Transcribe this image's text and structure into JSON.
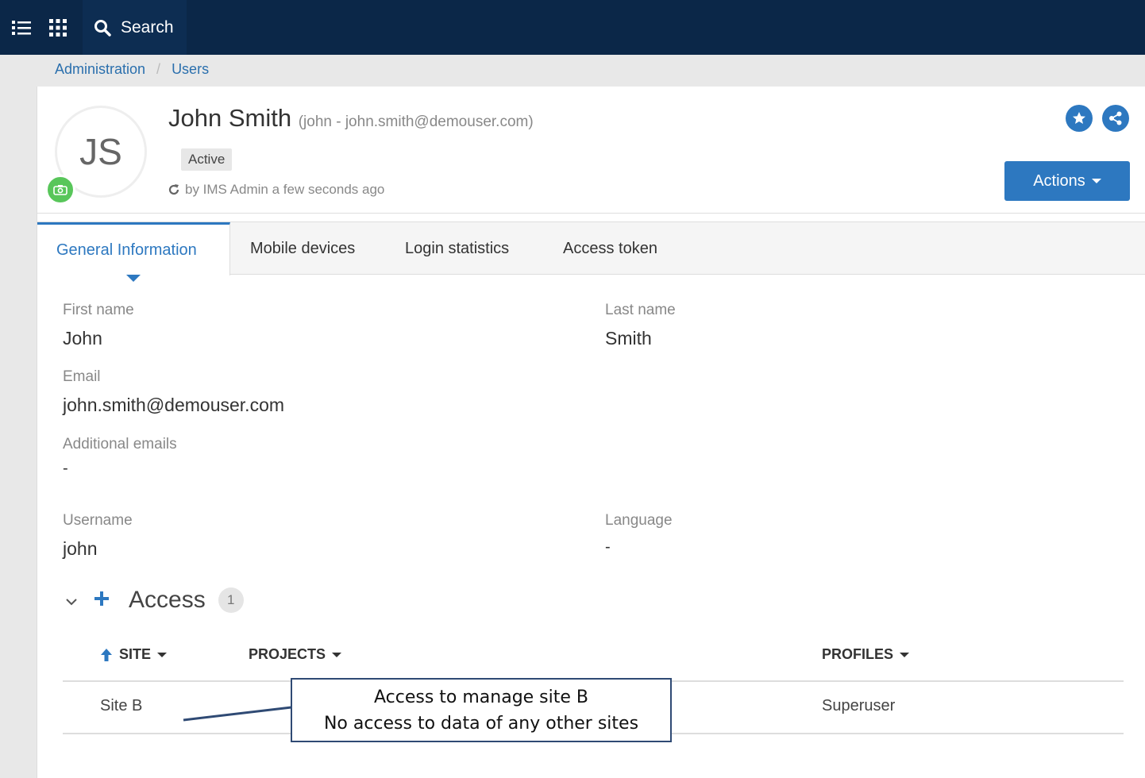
{
  "topbar": {
    "search_label": "Search"
  },
  "breadcrumb": {
    "items": [
      "Administration",
      "Users"
    ],
    "separator": "/"
  },
  "user": {
    "initials": "JS",
    "name": "John Smith",
    "subtitle": "(john - john.smith@demouser.com)",
    "status": "Active",
    "updated": "by IMS Admin a few seconds ago"
  },
  "header": {
    "actions_label": "Actions"
  },
  "tabs": [
    {
      "label": "General Information",
      "active": true
    },
    {
      "label": "Mobile devices"
    },
    {
      "label": "Login statistics"
    },
    {
      "label": "Access token"
    }
  ],
  "fields": {
    "first_name": {
      "label": "First name",
      "value": "John"
    },
    "last_name": {
      "label": "Last name",
      "value": "Smith"
    },
    "email": {
      "label": "Email",
      "value": "john.smith@demouser.com"
    },
    "additional_emails": {
      "label": "Additional emails",
      "value": "-"
    },
    "username": {
      "label": "Username",
      "value": "john"
    },
    "language": {
      "label": "Language",
      "value": "-"
    }
  },
  "access": {
    "title": "Access",
    "count": "1",
    "columns": {
      "site": "SITE",
      "projects": "PROJECTS",
      "profiles": "PROFILES"
    },
    "rows": [
      {
        "site": "Site B",
        "projects": "",
        "profiles": "Superuser"
      }
    ]
  },
  "callout": {
    "line1": "Access to manage site B",
    "line2": "No access to data of any other sites"
  },
  "colors": {
    "topbar": "#0b2748",
    "accent": "#2d78c0",
    "camera": "#58c65a"
  }
}
